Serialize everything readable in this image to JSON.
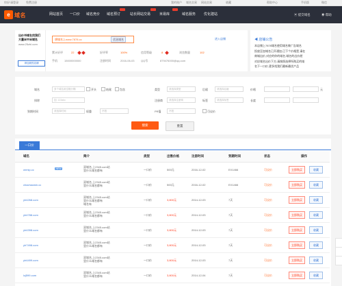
{
  "topbar": {
    "left": [
      "你好!请登录",
      "免费注册"
    ],
    "right": [
      "我的账户",
      "域名交易",
      "网站交易",
      "收藏",
      "帮助中心",
      "手机版",
      "微信"
    ]
  },
  "nav": {
    "logo_text": "域名",
    "items": [
      {
        "label": "网站首页",
        "hot": false
      },
      {
        "label": "一口价",
        "hot": false
      },
      {
        "label": "域名竞价",
        "hot": false
      },
      {
        "label": "域名预订",
        "hot": true
      },
      {
        "label": "站长网站交易",
        "hot": true
      },
      {
        "label": "米易库",
        "hot": true
      },
      {
        "label": "域名服务",
        "hot": false
      },
      {
        "label": "优化建站",
        "hot": false
      }
    ],
    "right": [
      "提交域名",
      "帮助"
    ]
  },
  "ad": {
    "lines": [
      "出价书域名找我们",
      "大量米中米域名",
      "www.25zhi.com"
    ],
    "button": "添加我的店铺"
  },
  "search": {
    "placeholder": "想域名上www.7878.cc",
    "button": "优选域名"
  },
  "stats": {
    "row1": [
      "累计好评",
      "22",
      "好评率",
      "100%",
      "信用等级",
      "8",
      "浏览数量",
      "102"
    ],
    "row2": [
      "手机",
      "15000000000",
      "注册时间",
      "2016-06-03",
      "QQ号",
      "879476000@qq.com"
    ]
  },
  "link_right": "进入店铺",
  "notice": {
    "title": "店铺公告",
    "lines": [
      "本店铺上7878域名使用域名做广告域名",
      "投放至加域名已开通加,已下个价格是,请在",
      "商城出价,对应的你的域名,域名的出价就",
      "对应域名出价下方,请按照选择所购买的域",
      "名下一口价,更多找我们最新最优产品"
    ]
  },
  "filters": {
    "domain_label": "域名",
    "domain_placeholder": "多个域名用空格分隔",
    "start_label": "开头",
    "end_label": "结尾",
    "include_label": "包含",
    "exclude_label": "排除",
    "exclude_placeholder": "如: 123abc",
    "type_label": "类型",
    "type_value": "请选择类型",
    "suffix_label": "后缀",
    "suffix_value": "请选择后缀",
    "price_label": "价格",
    "len_label": "长度",
    "reg_label": "注册商",
    "reg_value": "请选择注册商",
    "exp_label": "到期时间",
    "exp_value": "请选择时间",
    "rank_label": "权重",
    "rank_value": "不限",
    "pr_label": "PR值",
    "pr_value": "不限",
    "tag_label": "标签",
    "tag_value": "请选择标签",
    "check_label": "可议价",
    "unit": "元"
  },
  "buttons": {
    "search": "搜索",
    "reset": "重置"
  },
  "tab": "一口价",
  "table": {
    "headers": [
      "域名",
      "简介",
      "类型",
      "出售价格",
      "注册时间",
      "到期时间",
      "状态",
      "操作"
    ],
    "rows": [
      {
        "domain": "wrmip.cc",
        "tag": "NEW",
        "intro": [
          "双域名,上2345.com站",
          "里什么域名都有",
          ""
        ],
        "type": "一口价",
        "price": "500元",
        "date": "2016-12-02",
        "rank": "EX1466",
        "status": "可议价",
        "buy": "立即购买",
        "fav": "收藏",
        "hot": false
      },
      {
        "domain": "chachaowin.cc",
        "tag": "",
        "intro": [
          "双域名,上2345.com站",
          "里什么域名都有",
          ""
        ],
        "type": "一口价",
        "price": "500元",
        "date": "2016-12-02",
        "rank": "EX1466",
        "status": "可议价",
        "buy": "立即购买",
        "fav": "收藏",
        "hot": false
      },
      {
        "domain": "yh4268.com",
        "tag": "",
        "intro": [
          "双域名,上2345.com站",
          "里什么域名都有",
          "域名有"
        ],
        "type": "一口价",
        "price": "3,800元",
        "date": "2014-12-03",
        "rank": "7天",
        "status": "可议价",
        "buy": "立即购买",
        "fav": "收藏",
        "hot": true
      },
      {
        "domain": "yh4788.com",
        "tag": "",
        "intro": [
          "双域名,上2345.com站",
          "里什么域名都有",
          ""
        ],
        "type": "一口价",
        "price": "3,800元",
        "date": "2014-12-03",
        "rank": "7天",
        "status": "可议价",
        "buy": "立即购买",
        "fav": "收藏",
        "hot": true
      },
      {
        "domain": "yh4398.com",
        "tag": "",
        "intro": [
          "双域名,上2345.com站",
          "里什么域名都有",
          ""
        ],
        "type": "一口价",
        "price": "3,800元",
        "date": "2014-12-03",
        "rank": "7天",
        "status": "可议价",
        "buy": "立即购买",
        "fav": "收藏",
        "hot": true
      },
      {
        "domain": "yh7498.com",
        "tag": "",
        "intro": [
          "双域名,上2345.com站",
          "里什么域名都有",
          ""
        ],
        "type": "一口价",
        "price": "3,800元",
        "date": "2014-12-03",
        "rank": "7天",
        "status": "可议价",
        "buy": "立即购买",
        "fav": "收藏",
        "hot": true
      },
      {
        "domain": "yh4499.com",
        "tag": "",
        "intro": [
          "双域名,上2345.com站",
          "里什么域名都有",
          ""
        ],
        "type": "一口价",
        "price": "3,800元",
        "date": "2014-12-03",
        "rank": "7天",
        "status": "可议价",
        "buy": "立即购买",
        "fav": "收藏",
        "hot": true
      },
      {
        "domain": "lzj599.com",
        "tag": "",
        "intro": [
          "双域名,上2345.com站",
          "里什么域名都有",
          ""
        ],
        "type": "一口价",
        "price": "3,800元",
        "date": "2014-12-04",
        "rank": "7天",
        "status": "可议价",
        "buy": "立即购买",
        "fav": "收藏",
        "hot": true
      }
    ]
  }
}
